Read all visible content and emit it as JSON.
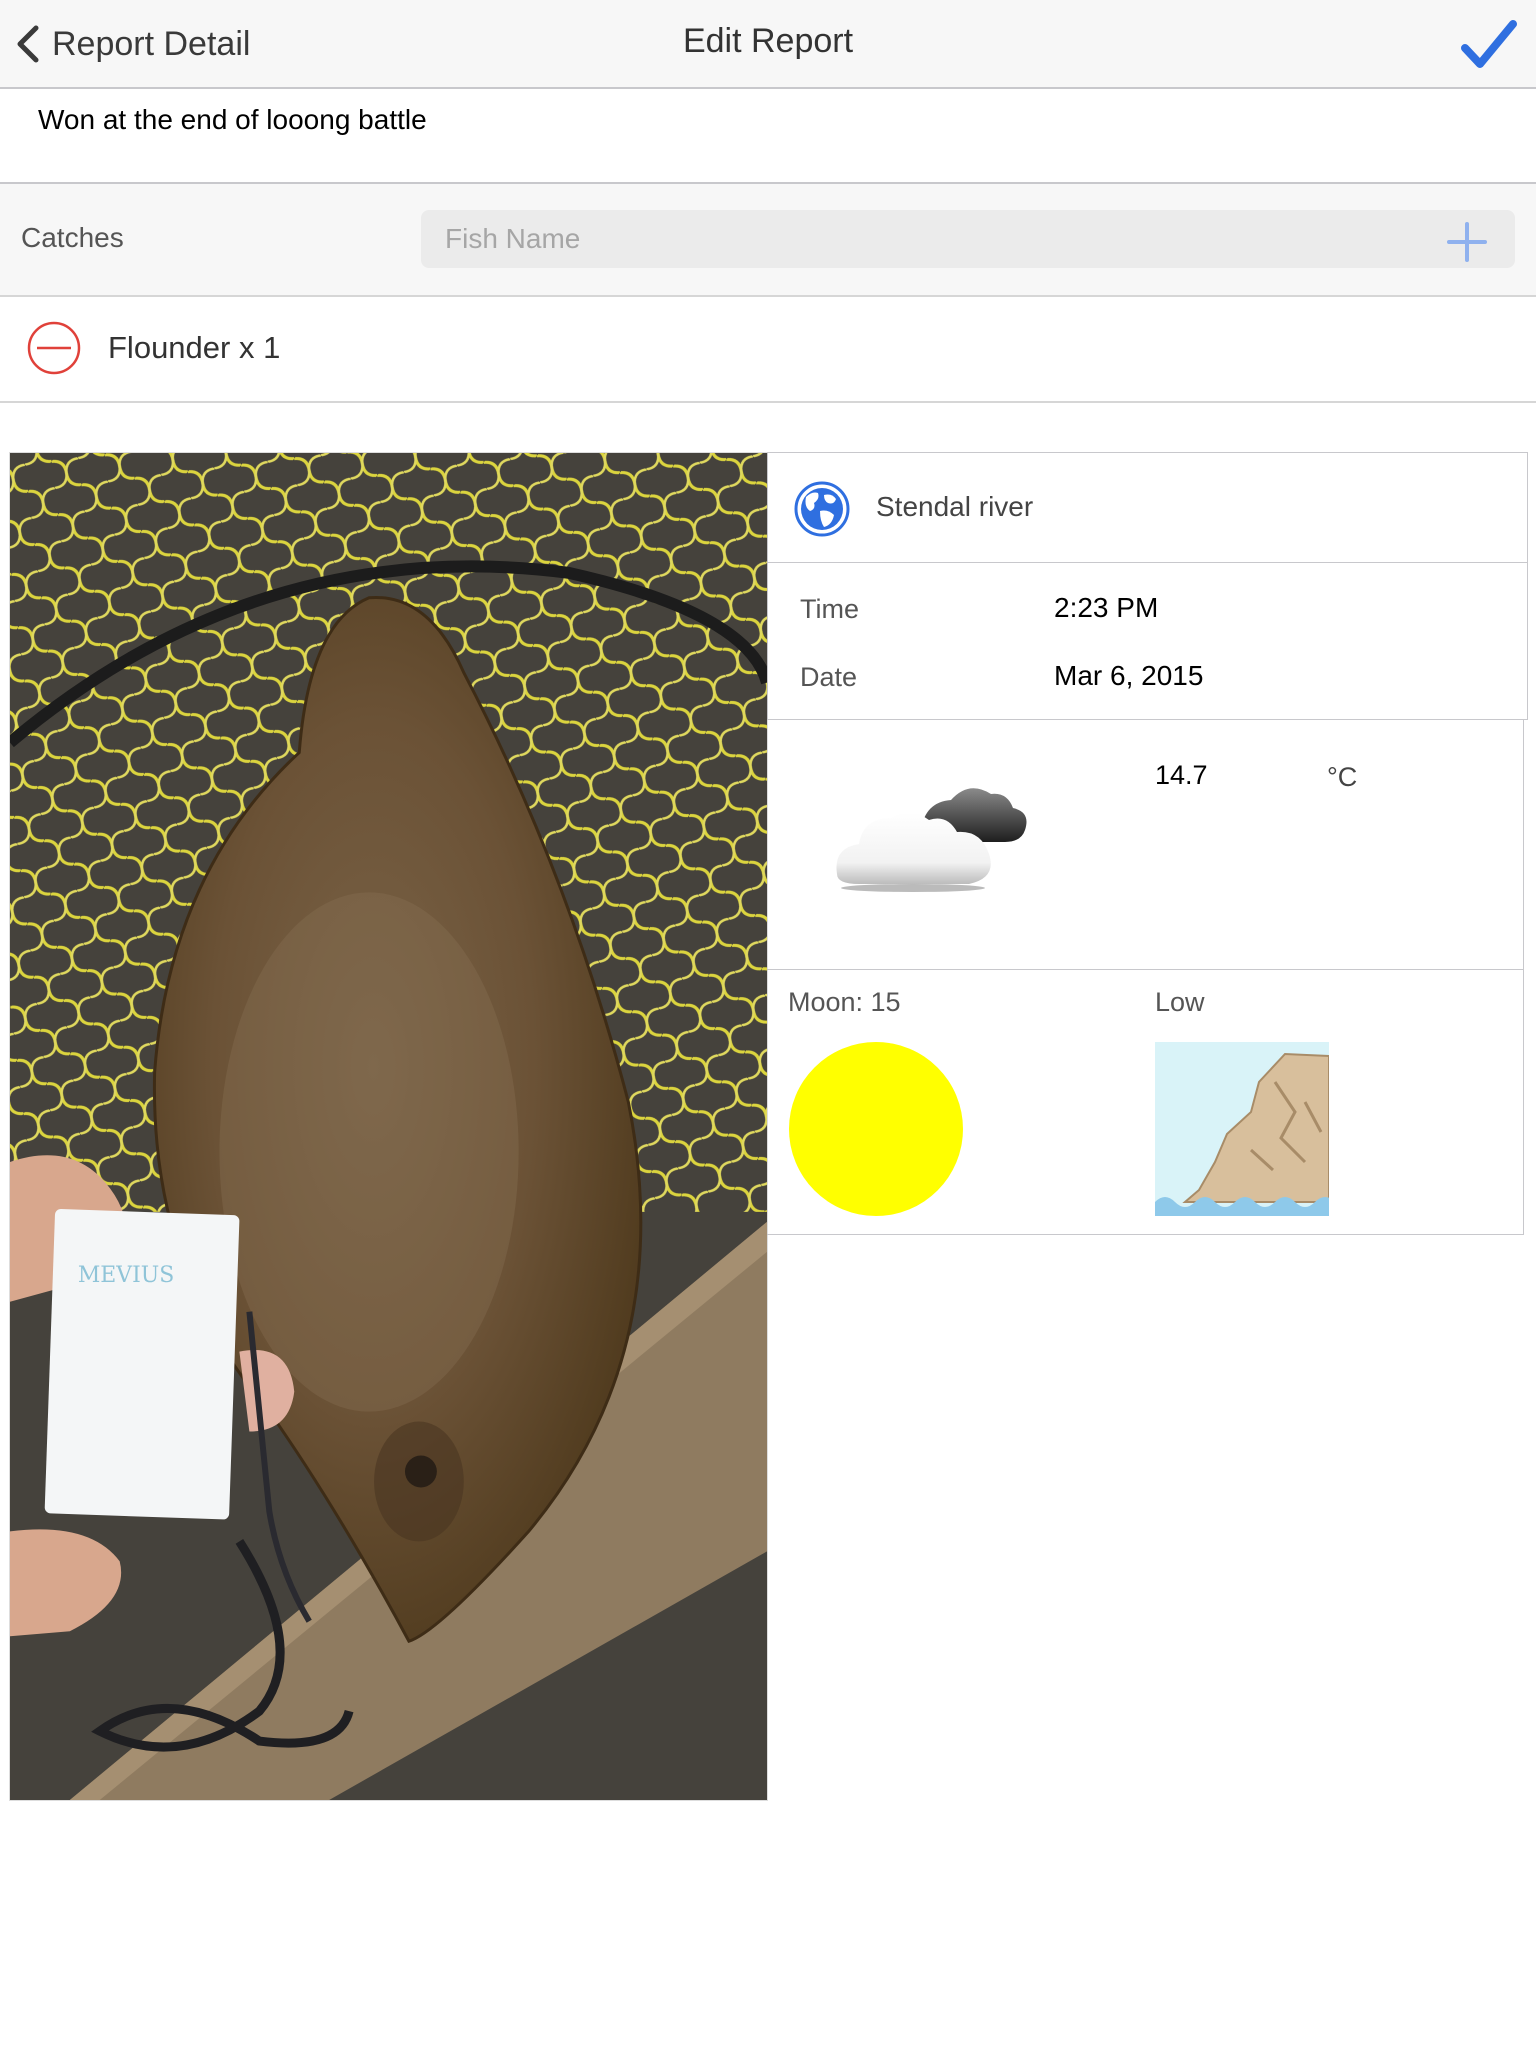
{
  "navbar": {
    "back_label": "Report Detail",
    "title": "Edit Report",
    "done_icon": "checkmark-icon",
    "accent_color": "#2f6fe0"
  },
  "report": {
    "note": "Won at the end of looong battle"
  },
  "catches": {
    "label": "Catches",
    "input_placeholder": "Fish Name",
    "input_value": "",
    "items": [
      {
        "label": "Flounder x 1"
      }
    ]
  },
  "location": {
    "name": "Stendal river"
  },
  "time": {
    "label": "Time",
    "value": "2:23 PM"
  },
  "date": {
    "label": "Date",
    "value": "Mar 6, 2015"
  },
  "weather": {
    "icon": "partly-cloudy-icon",
    "temperature": "14.7",
    "unit": "°C"
  },
  "moon": {
    "label": "Moon: 15",
    "color": "#ffff00"
  },
  "tide": {
    "label": "Low"
  }
}
